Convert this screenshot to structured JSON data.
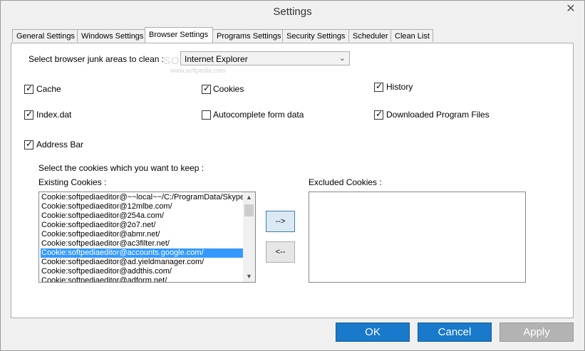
{
  "window": {
    "title": "Settings",
    "close": "✕"
  },
  "tabs": [
    {
      "label": "General Settings"
    },
    {
      "label": "Windows Settings"
    },
    {
      "label": "Browser Settings",
      "active": true
    },
    {
      "label": "Programs Settings"
    },
    {
      "label": "Security Settings"
    },
    {
      "label": "Scheduler"
    },
    {
      "label": "Clean List"
    }
  ],
  "browser": {
    "select_label": "Select browser junk areas to clean :",
    "selected_browser": "Internet Explorer",
    "watermark": "SOFTPEDIA",
    "watermark_url": "www.softpedia.com",
    "options": {
      "cache": {
        "label": "Cache",
        "checked": true
      },
      "cookies": {
        "label": "Cookies",
        "checked": true
      },
      "history": {
        "label": "History",
        "checked": true
      },
      "indexdat": {
        "label": "Index.dat",
        "checked": true
      },
      "autocomplete": {
        "label": "Autocomplete form data",
        "checked": false
      },
      "downloaded": {
        "label": "Downloaded Program Files",
        "checked": true
      },
      "addressbar": {
        "label": "Address Bar",
        "checked": true
      }
    },
    "cookies_prompt": "Select the cookies which you want to keep :",
    "existing_label": "Existing Cookies :",
    "excluded_label": "Excluded Cookies :",
    "existing_cookies": [
      "Cookie:softpediaeditor@~~local~~/C:/ProgramData/Skype",
      "Cookie:softpediaeditor@12mlbe.com/",
      "Cookie:softpediaeditor@254a.com/",
      "Cookie:softpediaeditor@2o7.net/",
      "Cookie:softpediaeditor@abmr.net/",
      "Cookie:softpediaeditor@ac3filter.net/",
      "Cookie:softpediaeditor@accounts.google.com/",
      "Cookie:softpediaeditor@ad.yieldmanager.com/",
      "Cookie:softpediaeditor@addthis.com/",
      "Cookie:softpediaeditor@adform.net/"
    ],
    "selected_cookie_index": 6,
    "move_right": "-->",
    "move_left": "<--"
  },
  "footer": {
    "ok": "OK",
    "cancel": "Cancel",
    "apply": "Apply"
  }
}
